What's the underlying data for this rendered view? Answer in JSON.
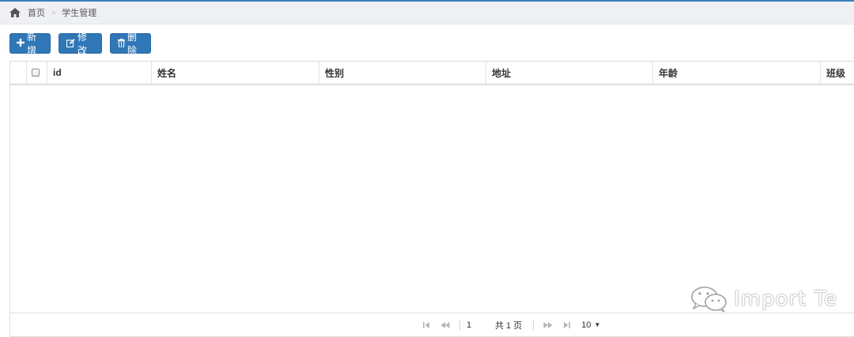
{
  "breadcrumb": {
    "home": "首页",
    "current": "学生管理"
  },
  "toolbar": {
    "add_label": "新增",
    "edit_label": "修改",
    "delete_label": "删除"
  },
  "table": {
    "columns": [
      "id",
      "姓名",
      "性别",
      "地址",
      "年龄",
      "班级"
    ],
    "rows": []
  },
  "pager": {
    "current_page": "1",
    "total_text": "共 1 页",
    "page_size": "10"
  },
  "watermark": {
    "text": "Import Te"
  },
  "colors": {
    "accent": "#2f77b6",
    "top_bar": "#eef0f3"
  }
}
